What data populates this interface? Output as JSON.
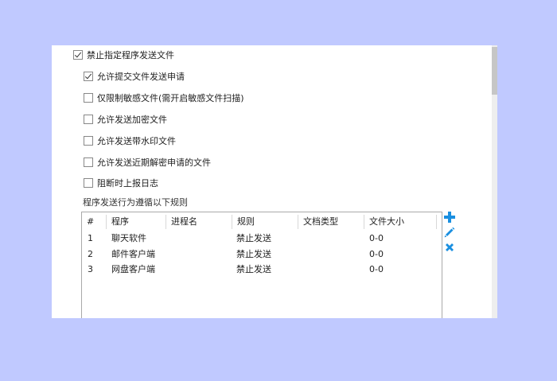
{
  "options": [
    {
      "label": "禁止指定程序发送文件",
      "checked": true
    },
    {
      "label": "允许提交文件发送申请",
      "checked": true
    },
    {
      "label": "仅限制敏感文件(需开启敏感文件扫描)",
      "checked": false
    },
    {
      "label": "允许发送加密文件",
      "checked": false
    },
    {
      "label": "允许发送带水印文件",
      "checked": false
    },
    {
      "label": "允许发送近期解密申请的文件",
      "checked": false
    },
    {
      "label": "阻断时上报日志",
      "checked": false
    }
  ],
  "rules_caption": "程序发送行为遵循以下规则",
  "table": {
    "columns": [
      "#",
      "程序",
      "进程名",
      "规则",
      "文档类型",
      "文件大小"
    ],
    "rows": [
      [
        "1",
        "聊天软件",
        "",
        "禁止发送",
        "",
        "0-0"
      ],
      [
        "2",
        "邮件客户端",
        "",
        "禁止发送",
        "",
        "0-0"
      ],
      [
        "3",
        "网盘客户端",
        "",
        "禁止发送",
        "",
        "0-0"
      ]
    ]
  },
  "toolbar": {
    "icons": [
      "add-icon",
      "edit-icon",
      "delete-icon"
    ],
    "accent_color": "#1a8fe0"
  }
}
